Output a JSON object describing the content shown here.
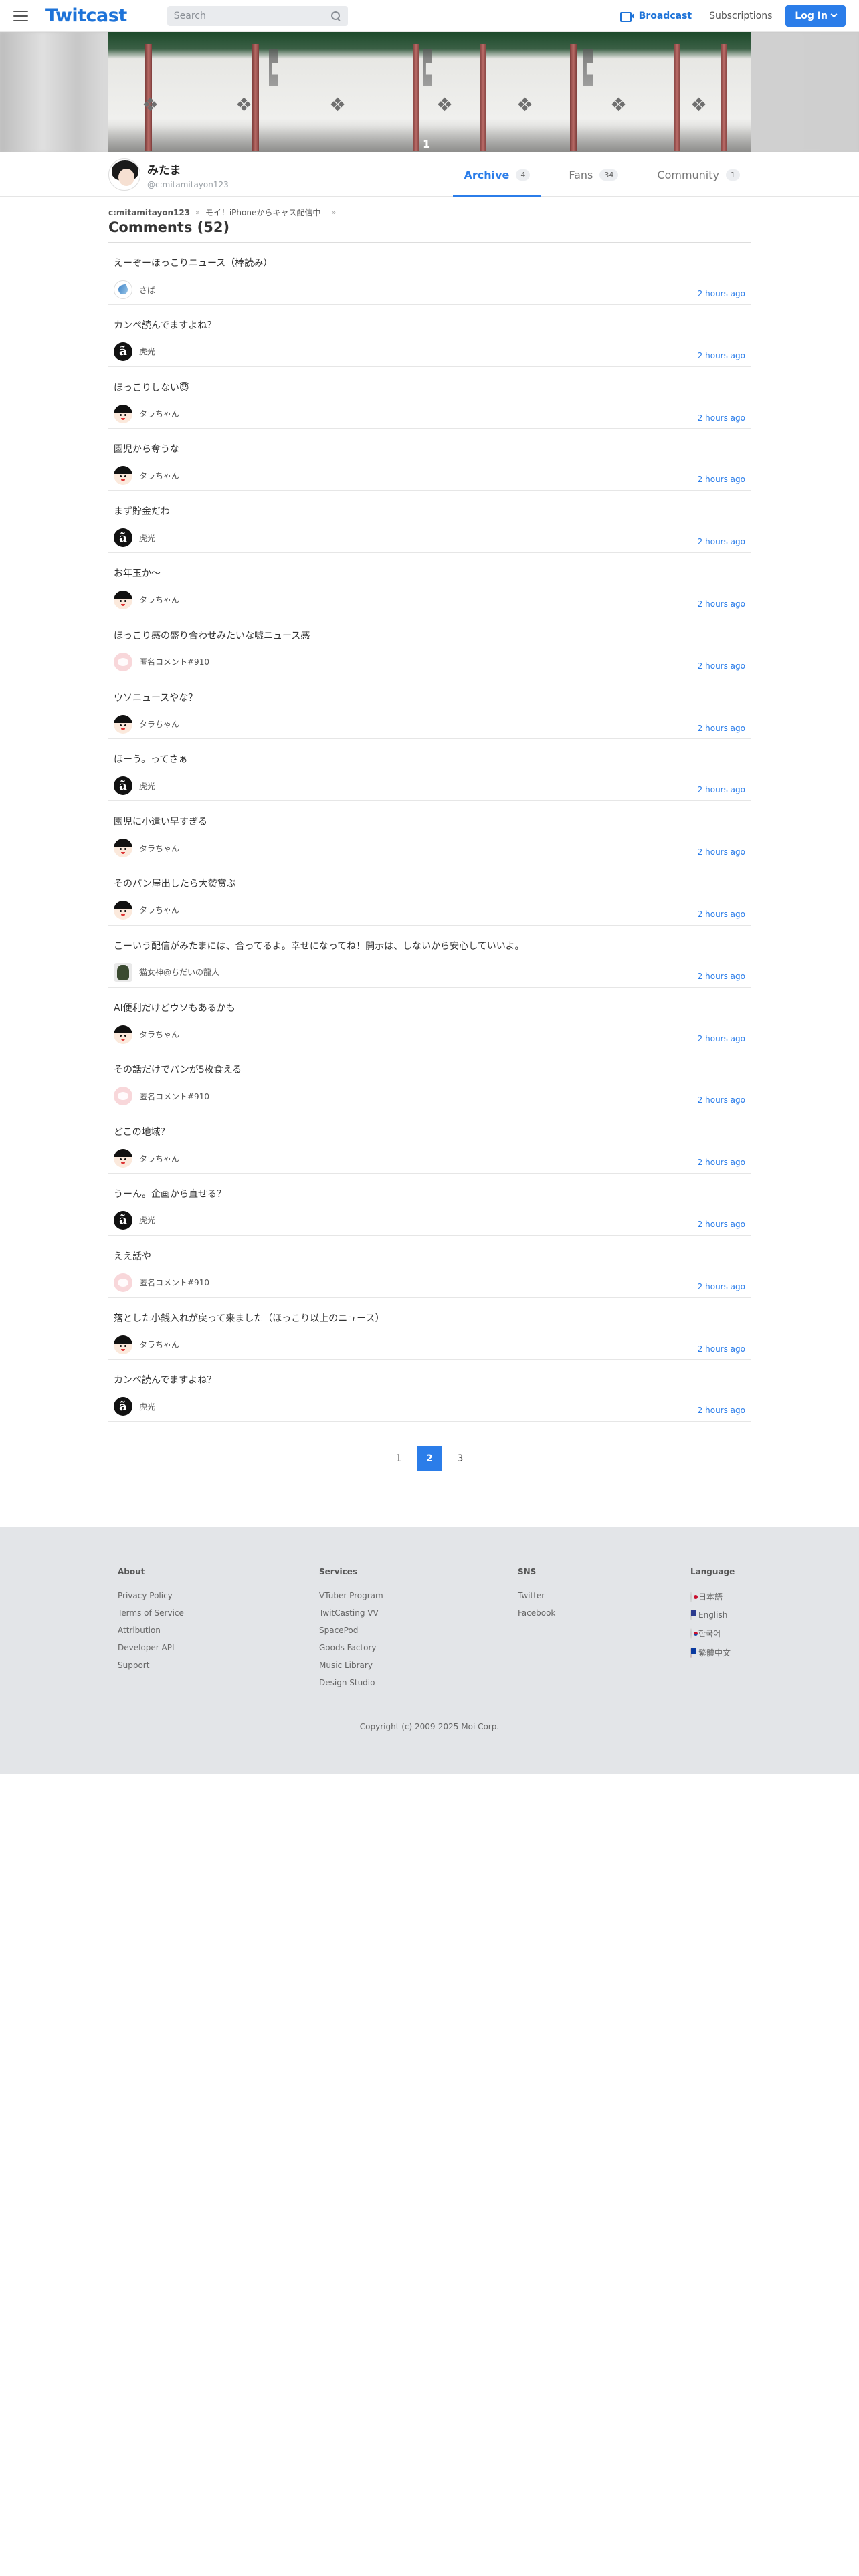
{
  "header": {
    "logo": "Twitcast",
    "search_placeholder": "Search",
    "broadcast_label": "Broadcast",
    "subscriptions_label": "Subscriptions",
    "login_label": "Log In"
  },
  "banner": {
    "overlay_number": "1"
  },
  "profile": {
    "name": "みたま",
    "id": "@c:mitamitayon123"
  },
  "tabs": [
    {
      "label": "Archive",
      "count": "4"
    },
    {
      "label": "Fans",
      "count": "34"
    },
    {
      "label": "Community",
      "count": "1"
    }
  ],
  "breadcrumb": {
    "user": "c:mitamitayon123",
    "movie": "モイ！iPhoneからキャス配信中 -"
  },
  "heading": "Comments (52)",
  "comments": [
    {
      "text": "えーぞーほっこりニュース（棒読み）",
      "user": "さば",
      "avatar": "saba",
      "time": "2 hours ago"
    },
    {
      "text": "カンペ読んでますよね？",
      "user": "虎光",
      "avatar": "tora",
      "time": "2 hours ago"
    },
    {
      "text": "ほっこりしない😇",
      "user": "タラちゃん",
      "avatar": "tara",
      "time": "2 hours ago"
    },
    {
      "text": "園児から奪うな",
      "user": "タラちゃん",
      "avatar": "tara",
      "time": "2 hours ago"
    },
    {
      "text": "まず貯金だわ",
      "user": "虎光",
      "avatar": "tora",
      "time": "2 hours ago"
    },
    {
      "text": "お年玉か〜",
      "user": "タラちゃん",
      "avatar": "tara",
      "time": "2 hours ago"
    },
    {
      "text": "ほっこり感の盛り合わせみたいな嘘ニュース感",
      "user": "匿名コメント#910",
      "avatar": "anon",
      "time": "2 hours ago"
    },
    {
      "text": "ウソニュースやな？",
      "user": "タラちゃん",
      "avatar": "tara",
      "time": "2 hours ago"
    },
    {
      "text": "ほーう。ってさぁ",
      "user": "虎光",
      "avatar": "tora",
      "time": "2 hours ago"
    },
    {
      "text": "園児に小遣い早すぎる",
      "user": "タラちゃん",
      "avatar": "tara",
      "time": "2 hours ago"
    },
    {
      "text": "そのパン屋出したら大赞赏ぶ",
      "user": "タラちゃん",
      "avatar": "tara",
      "time": "2 hours ago"
    },
    {
      "text": "こーいう配信がみたまには、合ってるよ。幸せになってね！開示は、しないから安心していいよ。",
      "user": "猫女神@ちだいの龍人",
      "avatar": "cat",
      "time": "2 hours ago"
    },
    {
      "text": "AI便利だけどウソもあるかも",
      "user": "タラちゃん",
      "avatar": "tara",
      "time": "2 hours ago"
    },
    {
      "text": "その話だけでパンが5枚食える",
      "user": "匿名コメント#910",
      "avatar": "anon",
      "time": "2 hours ago"
    },
    {
      "text": "どこの地域？",
      "user": "タラちゃん",
      "avatar": "tara",
      "time": "2 hours ago"
    },
    {
      "text": "うーん。企画から直せる？",
      "user": "虎光",
      "avatar": "tora",
      "time": "2 hours ago"
    },
    {
      "text": "ええ話や",
      "user": "匿名コメント#910",
      "avatar": "anon",
      "time": "2 hours ago"
    },
    {
      "text": "落とした小銭入れが戻って来ました（ほっこり以上のニュース）",
      "user": "タラちゃん",
      "avatar": "tara",
      "time": "2 hours ago"
    },
    {
      "text": "カンペ読んでますよね？",
      "user": "虎光",
      "avatar": "tora",
      "time": "2 hours ago"
    }
  ],
  "pagination": {
    "pages": [
      "1",
      "2",
      "3"
    ],
    "current": "2"
  },
  "footer": {
    "about": {
      "title": "About",
      "links": [
        "Privacy Policy",
        "Terms of Service",
        "Attribution",
        "Developer API",
        "Support"
      ]
    },
    "services": {
      "title": "Services",
      "links": [
        "VTuber Program",
        "TwitCasting VV",
        "SpacePod",
        "Goods Factory",
        "Music Library",
        "Design Studio"
      ]
    },
    "sns": {
      "title": "SNS",
      "links": [
        "Twitter",
        "Facebook"
      ]
    },
    "language": {
      "title": "Language",
      "items": [
        {
          "label": "日本語",
          "flag": "jp"
        },
        {
          "label": "English",
          "flag": "us"
        },
        {
          "label": "한국어",
          "flag": "kr"
        },
        {
          "label": "繁體中文",
          "flag": "tw"
        }
      ]
    },
    "copyright": "Copyright (c) 2009-2025 Moi Corp."
  }
}
